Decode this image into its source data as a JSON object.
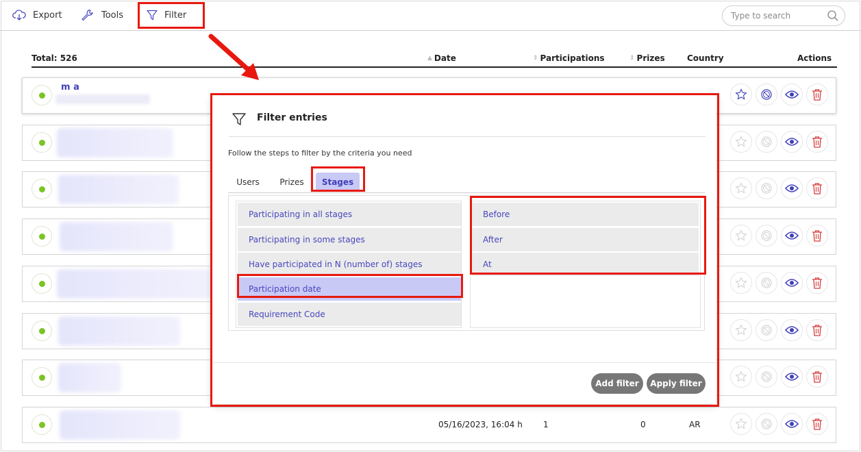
{
  "toolbar": {
    "export_label": "Export",
    "tools_label": "Tools",
    "filter_label": "Filter",
    "search_placeholder": "Type to search"
  },
  "table": {
    "total": "Total: 526",
    "columns": {
      "date": "Date",
      "participations": "Participations",
      "prizes": "Prizes",
      "country": "Country",
      "actions": "Actions"
    },
    "first_user_name": "m a",
    "last_row": {
      "date": "05/16/2023, 16:04 h",
      "participations": "1",
      "prizes": "0",
      "country": "AR"
    }
  },
  "modal": {
    "title": "Filter entries",
    "description": "Follow the steps to filter by the criteria you need",
    "tabs": [
      "Users",
      "Prizes",
      "Stages"
    ],
    "active_tab": "Stages",
    "left_options": [
      "Participating in all stages",
      "Participating in some stages",
      "Have participated in N (number of) stages",
      "Participation date",
      "Requirement Code"
    ],
    "selected_option": "Participation date",
    "right_options": [
      "Before",
      "After",
      "At"
    ],
    "add_filter": "Add filter",
    "apply_filter": "Apply filter"
  },
  "colors": {
    "accent": "#3f3fb8",
    "tab_active_bg": "#c9c9f6",
    "status_active": "#7dc325",
    "delete": "#d63a3a",
    "annotation": "#e8180f"
  }
}
